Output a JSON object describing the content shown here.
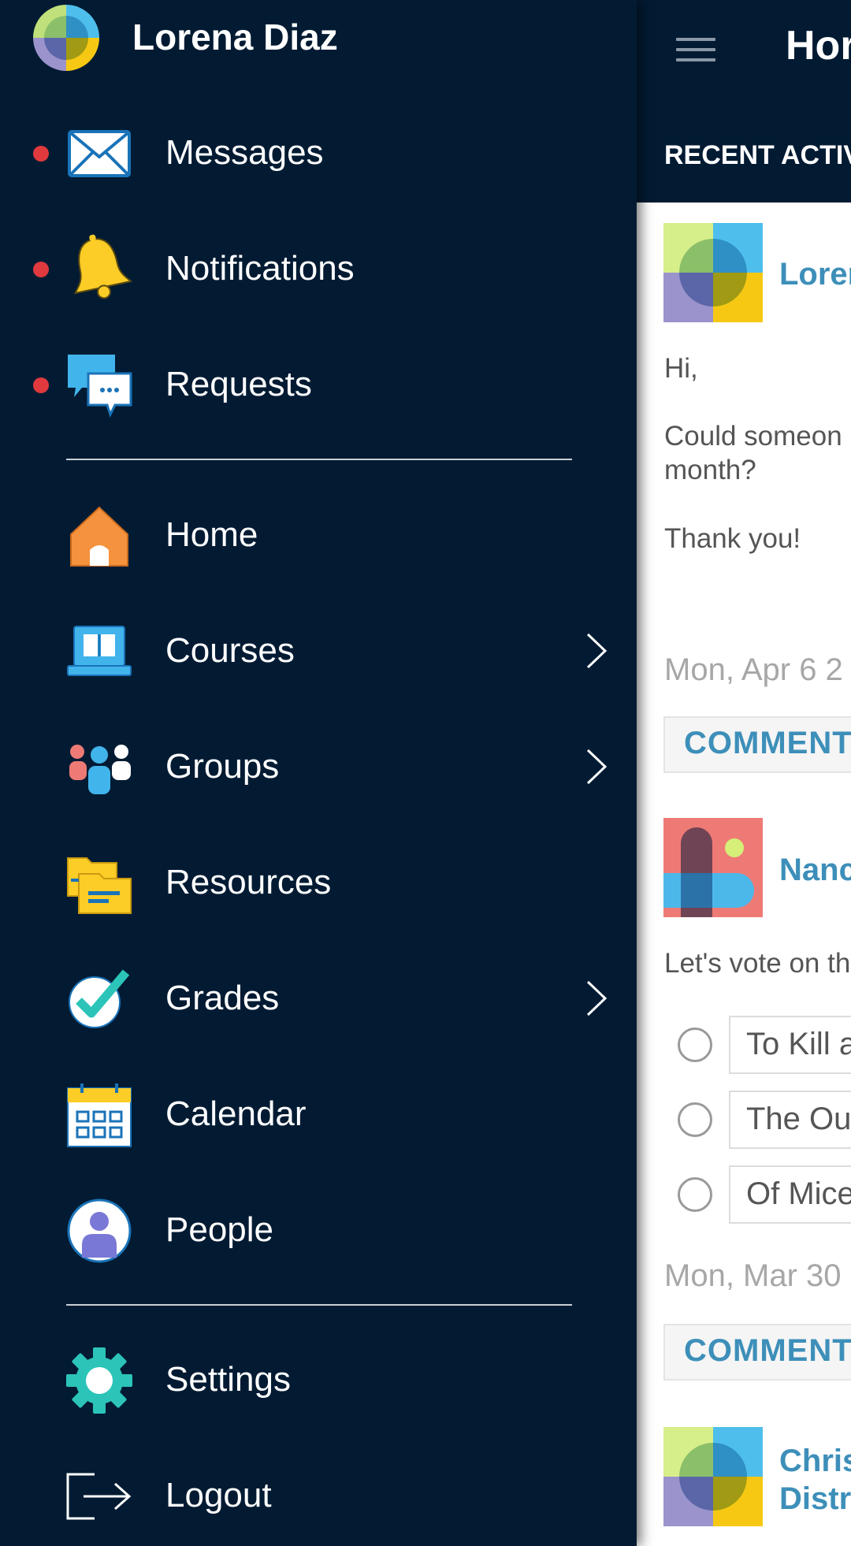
{
  "drawer": {
    "user_name": "Lorena Diaz",
    "items_top": [
      {
        "label": "Messages",
        "icon": "envelope-icon",
        "unread": true
      },
      {
        "label": "Notifications",
        "icon": "bell-icon",
        "unread": true
      },
      {
        "label": "Requests",
        "icon": "chat-bubbles-icon",
        "unread": true
      }
    ],
    "items_main": [
      {
        "label": "Home",
        "icon": "house-icon"
      },
      {
        "label": "Courses",
        "icon": "laptop-book-icon",
        "has_submenu": true
      },
      {
        "label": "Groups",
        "icon": "people-group-icon",
        "has_submenu": true
      },
      {
        "label": "Resources",
        "icon": "folders-icon"
      },
      {
        "label": "Grades",
        "icon": "checkmark-icon",
        "has_submenu": true
      },
      {
        "label": "Calendar",
        "icon": "calendar-icon"
      },
      {
        "label": "People",
        "icon": "person-icon"
      }
    ],
    "items_bottom": [
      {
        "label": "Settings",
        "icon": "gear-icon"
      },
      {
        "label": "Logout",
        "icon": "logout-icon"
      }
    ]
  },
  "main": {
    "title": "Hor",
    "section_label": "RECENT ACTIV",
    "posts": [
      {
        "author": "Loren",
        "lines": [
          "Hi,",
          "Could someon",
          "month?",
          "Thank you!"
        ],
        "date": "Mon, Apr 6 2",
        "comment_label": "COMMENT"
      },
      {
        "author": "Nanc",
        "lines": [
          "Let's vote on th"
        ],
        "poll_options": [
          "To Kill a",
          "The Ou",
          "Of Mice"
        ],
        "date": "Mon, Mar 30",
        "comment_label": "COMMENT"
      },
      {
        "author_line1": "Chris",
        "author_line2": "Distr"
      }
    ]
  },
  "colors": {
    "drawer_bg": "#021b33",
    "accent_link": "#3d8fb9",
    "unread_dot": "#e0393e"
  }
}
